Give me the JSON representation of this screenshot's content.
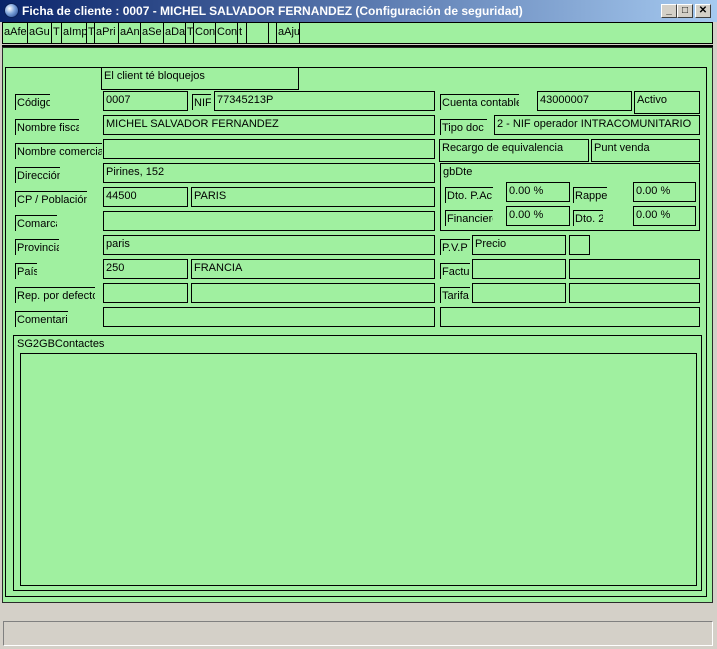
{
  "window": {
    "title": "Ficha de cliente :  0007 - MICHEL SALVADOR FERNANDEZ (Configuración de seguridad)",
    "minimize": "_",
    "maximize": "□",
    "close": "✕"
  },
  "toolbar": {
    "buttons": [
      "aAfe",
      "aGu",
      "T",
      "aImp",
      "T",
      "aPri",
      "aAn",
      "aSe",
      "aDa",
      "T",
      "Con",
      "Con",
      "t",
      "",
      "",
      "aAju"
    ]
  },
  "banner": {
    "blocked": "El client té bloquejos"
  },
  "form": {
    "codigo_label": "Código",
    "codigo": "0007",
    "nif_label": "NIF",
    "nif": "77345213P",
    "cuenta_label": "Cuenta contable",
    "cuenta": "43000007",
    "estado": "Activo",
    "nombre_fiscal_label": "Nombre fiscal",
    "nombre_fiscal": "MICHEL SALVADOR FERNANDEZ",
    "tipo_doc_label": "Tipo doc",
    "tipo_doc": "2 - NIF operador INTRACOMUNITARIO",
    "nombre_comercial_label": "Nombre comercial",
    "nombre_comercial": "",
    "recargo_label": "Recargo de equivalencia",
    "punt_venda_label": "Punt venda",
    "direccion_label": "Dirección",
    "direccion": "Pirines, 152",
    "gbdte_label": "gbDte",
    "cp_label": "CP / Población",
    "cp": "44500",
    "poblacion": "PARIS",
    "dto_pac_label": "Dto. P.Ac",
    "dto_pac": "0.00 %",
    "rappel_label": "Rappe",
    "rappel": "0.00 %",
    "comarca_label": "Comarca",
    "comarca": "",
    "financiero_label": "Financiero",
    "financiero": "0.00 %",
    "dto2_label": "Dto. 2",
    "dto2": "0.00 %",
    "provincia_label": "Provincia",
    "provincia": "paris",
    "pvp_label": "P.V.P",
    "pvp": "Precio",
    "pais_label": "País",
    "pais_code": "250",
    "pais": "FRANCIA",
    "factura_label": "Factu",
    "rep_label": "Rep. por defecto",
    "tarifa_label": "Tarifa",
    "comentario_label": "Comentario",
    "contactes_label": "SG2GBContactes"
  },
  "colors": {
    "panel": "#a0f0a0",
    "titlebar": "#0a246a"
  }
}
